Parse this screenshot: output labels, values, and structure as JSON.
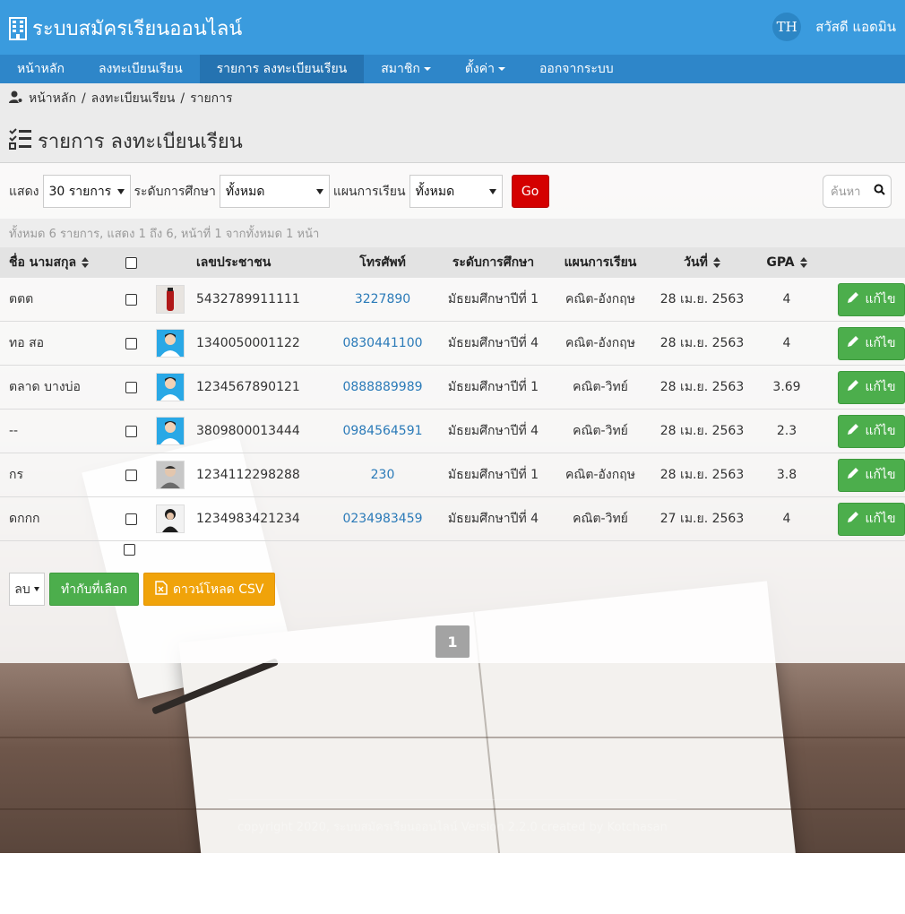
{
  "header": {
    "title": "ระบบสมัครเรียนออนไลน์",
    "avatar": "TH",
    "greeting": "สวัสดี แอดมิน",
    "brand_color": "#3a9bde"
  },
  "nav": {
    "items": [
      {
        "label": "หน้าหลัก",
        "active": false,
        "dropdown": false
      },
      {
        "label": "ลงทะเบียนเรียน",
        "active": false,
        "dropdown": false
      },
      {
        "label": "รายการ ลงทะเบียนเรียน",
        "active": true,
        "dropdown": false
      },
      {
        "label": "สมาชิก",
        "active": false,
        "dropdown": true
      },
      {
        "label": "ตั้งค่า",
        "active": false,
        "dropdown": true
      },
      {
        "label": "ออกจากระบบ",
        "active": false,
        "dropdown": false
      }
    ]
  },
  "breadcrumb": [
    "หน้าหลัก",
    "ลงทะเบียนเรียน",
    "รายการ"
  ],
  "page_title": "รายการ ลงทะเบียนเรียน",
  "filter": {
    "show_label": "แสดง",
    "show_value": "30 รายการ",
    "level_label": "ระดับการศึกษา",
    "level_value": "ทั้งหมด",
    "plan_label": "แผนการเรียน",
    "plan_value": "ทั้งหมด",
    "go": "Go",
    "search_placeholder": "ค้นหา"
  },
  "summary": "ทั้งหมด 6 รายการ, แสดง 1 ถึง 6, หน้าที่ 1 จากทั้งหมด 1 หน้า",
  "table": {
    "headers": {
      "name": "ชื่อ นามสกุล",
      "id": "เลขประชาชน",
      "tel": "โทรศัพท์",
      "level": "ระดับการศึกษา",
      "plan": "แผนการเรียน",
      "date": "วันที่",
      "gpa": "GPA"
    },
    "edit_label": "แก้ไข",
    "rows": [
      {
        "name": "ตตต",
        "id": "5432789911111",
        "tel": "3227890",
        "level": "มัธยมศึกษาปีที่ 1",
        "plan": "คณิต-อังกฤษ",
        "date": "28 เม.ย. 2563",
        "gpa": "4",
        "thumb": "red-bottle"
      },
      {
        "name": "ทอ สอ",
        "id": "1340050001122",
        "tel": "0830441100",
        "level": "มัธยมศึกษาปีที่ 4",
        "plan": "คณิต-อังกฤษ",
        "date": "28 เม.ย. 2563",
        "gpa": "4",
        "thumb": "student-blue"
      },
      {
        "name": "ตลาด บางบ่อ",
        "id": "1234567890121",
        "tel": "0888889989",
        "level": "มัธยมศึกษาปีที่ 1",
        "plan": "คณิต-วิทย์",
        "date": "28 เม.ย. 2563",
        "gpa": "3.69",
        "thumb": "student-blue"
      },
      {
        "name": "--",
        "id": "3809800013444",
        "tel": "0984564591",
        "level": "มัธยมศึกษาปีที่ 4",
        "plan": "คณิต-วิทย์",
        "date": "28 เม.ย. 2563",
        "gpa": "2.3",
        "thumb": "student-blue"
      },
      {
        "name": "กร",
        "id": "1234112298288",
        "tel": "230",
        "level": "มัธยมศึกษาปีที่ 1",
        "plan": "คณิต-อังกฤษ",
        "date": "28 เม.ย. 2563",
        "gpa": "3.8",
        "thumb": "student-gray"
      },
      {
        "name": "ดกกก",
        "id": "1234983421234",
        "tel": "0234983459",
        "level": "มัธยมศึกษาปีที่ 4",
        "plan": "คณิต-วิทย์",
        "date": "27 เม.ย. 2563",
        "gpa": "4",
        "thumb": "student-dark"
      }
    ]
  },
  "bulk": {
    "action_value": "ลบ",
    "apply": "ทำกับที่เลือก",
    "csv": "ดาวน์โหลด CSV"
  },
  "pagination": {
    "current": "1"
  },
  "footer": "copyright 2020, ระบบสมัครเรียนออนไลน์ Version 2.2.0 created by Kotchasan",
  "colors": {
    "nav": "#2e86c9",
    "nav_active": "#2573b1",
    "go": "#d40000",
    "edit": "#4cae4c",
    "csv": "#f0a30a",
    "link": "#2a7ab8"
  }
}
